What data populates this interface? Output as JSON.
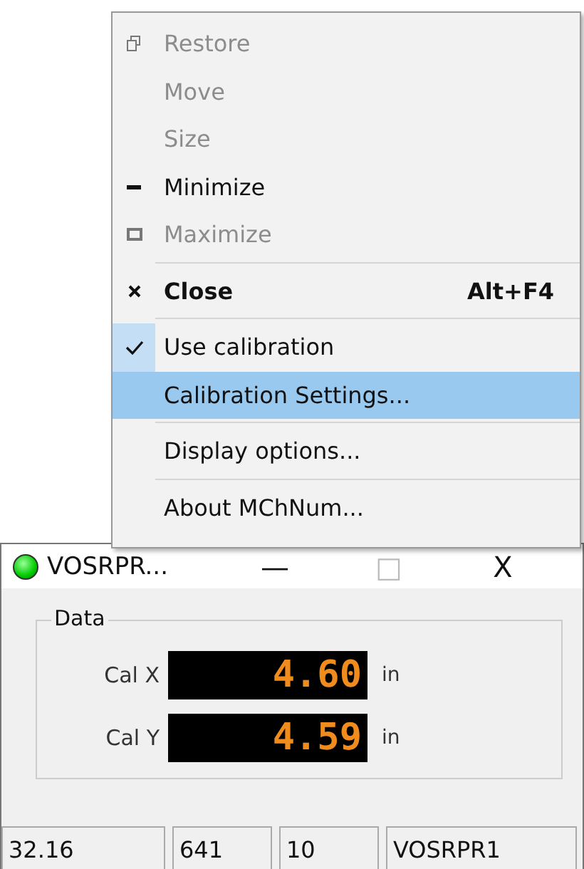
{
  "window": {
    "title": "VOSRPR...",
    "led_on": true,
    "minimize": "—",
    "maximize": "□",
    "close": "X",
    "group": {
      "title": "Data",
      "rows": [
        {
          "label": "Cal X",
          "value": "4.60",
          "unit": "in"
        },
        {
          "label": "Cal Y",
          "value": "4.59",
          "unit": "in"
        }
      ]
    },
    "status_bar": [
      "32.16",
      "641",
      "10",
      "VOSRPR1"
    ]
  },
  "menu": {
    "groups": [
      [
        {
          "kind": "restore",
          "label": "Restore",
          "disabled": true,
          "checked": false,
          "selected": false,
          "default": false
        },
        {
          "kind": "plain",
          "label": "Move",
          "disabled": true,
          "checked": false,
          "selected": false,
          "default": false
        },
        {
          "kind": "plain",
          "label": "Size",
          "disabled": true,
          "checked": false,
          "selected": false,
          "default": false
        },
        {
          "kind": "minimize",
          "label": "Minimize",
          "disabled": false,
          "checked": false,
          "selected": false,
          "default": false
        },
        {
          "kind": "maximize",
          "label": "Maximize",
          "disabled": true,
          "checked": false,
          "selected": false,
          "default": false
        }
      ],
      [
        {
          "kind": "close",
          "label": "Close",
          "shortcut": "Alt+F4",
          "disabled": false,
          "checked": false,
          "selected": false,
          "default": true
        }
      ],
      [
        {
          "kind": "plain",
          "label": "Use calibration",
          "disabled": false,
          "checked": true,
          "selected": false,
          "default": false
        },
        {
          "kind": "plain",
          "label": "Calibration Settings...",
          "disabled": false,
          "checked": false,
          "selected": true,
          "default": false
        }
      ],
      [
        {
          "kind": "plain",
          "label": "Display options...",
          "disabled": false,
          "checked": false,
          "selected": false,
          "default": false
        }
      ],
      [
        {
          "kind": "plain",
          "label": "About MChNum...",
          "disabled": false,
          "checked": false,
          "selected": false,
          "default": false
        }
      ]
    ]
  }
}
